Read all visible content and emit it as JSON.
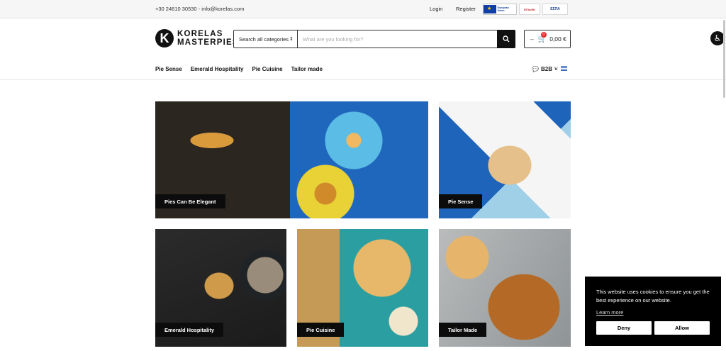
{
  "topbar": {
    "contact": "+30 24610 30530 - info@korelas.com",
    "login": "Login",
    "register": "Register",
    "eu_logo_text": "European Union",
    "epanek_text": "ΕΠΑνΕΚ",
    "espa_text": "ΕΣΠΑ"
  },
  "header": {
    "logo_mark": "K",
    "logo_line1": "KORELAS",
    "logo_line2": "MASTERPIES",
    "search": {
      "category_label": "Search all categories",
      "placeholder": "What are you looking for?"
    },
    "cart": {
      "count": "0",
      "total": "0,00 €"
    }
  },
  "nav": {
    "items": [
      "Pie Sense",
      "Emerald Hospitality",
      "Pie Cuisine",
      "Tailor made"
    ],
    "b2b": "B2B"
  },
  "tiles": [
    {
      "label": "Pies Can Be Elegant"
    },
    {
      "label": "Pie Sense"
    },
    {
      "label": "Emerald Hospitality"
    },
    {
      "label": "Pie Cuisine"
    },
    {
      "label": "Tailor Made"
    }
  ],
  "cookie": {
    "message": "This website uses cookies to ensure you get the best experience on our website.",
    "learn_more": "Learn more",
    "deny": "Deny",
    "allow": "Allow"
  },
  "colors": {
    "accent": "#111111",
    "badge": "#e32b2b"
  }
}
